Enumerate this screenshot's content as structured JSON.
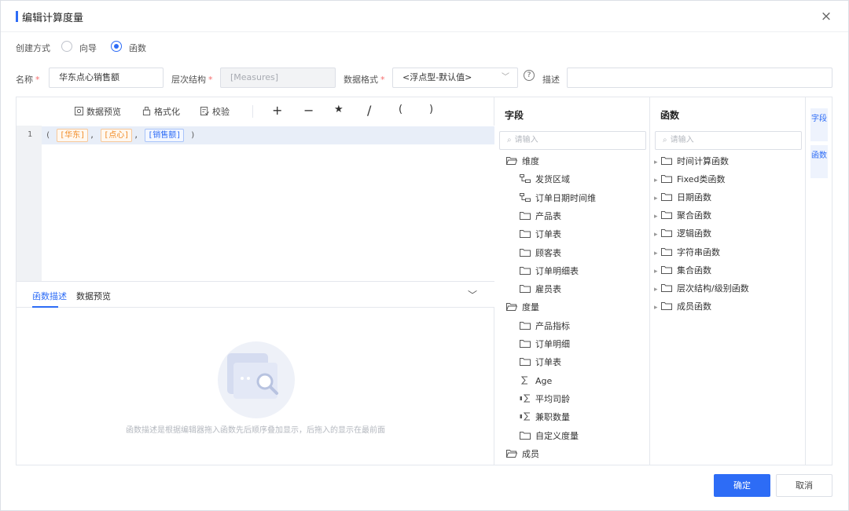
{
  "dialog": {
    "title": "编辑计算度量",
    "close": "×"
  },
  "creation": {
    "label": "创建方式",
    "options": [
      "向导",
      "函数"
    ],
    "selected_index": 1
  },
  "form": {
    "name_label": "名称",
    "name_value": "华东点心销售额",
    "hierarchy_label": "层次结构",
    "hierarchy_value": "[Measures]",
    "format_label": "数据格式",
    "format_value": "<浮点型-默认值>",
    "help_icon": "?",
    "desc_label": "描述",
    "desc_value": "",
    "required_mark": "*"
  },
  "toolbar": {
    "preview": "数据预览",
    "format": "格式化",
    "validate": "校验",
    "ops": [
      "+",
      "−",
      "★",
      "/",
      "(",
      ")"
    ]
  },
  "editor": {
    "line_number": "1",
    "open_paren": "(",
    "close_paren": ")",
    "comma": ",",
    "tokens": [
      "[华东]",
      "[点心]",
      "[销售额]"
    ]
  },
  "bottom_panel": {
    "tabs": [
      "函数描述",
      "数据预览"
    ],
    "active_tab": 0,
    "empty_text": "函数描述是根据编辑器拖入函数先后顺序叠加显示，后拖入的显示在最前面"
  },
  "fields": {
    "title": "字段",
    "search_placeholder": "请输入",
    "tree": [
      {
        "label": "维度",
        "level": 0,
        "icon": "folder-open-icon"
      },
      {
        "label": "发货区域",
        "level": 1,
        "icon": "hierarchy-icon"
      },
      {
        "label": "订单日期时间维",
        "level": 1,
        "icon": "hierarchy-icon"
      },
      {
        "label": "产品表",
        "level": 1,
        "icon": "folder-icon"
      },
      {
        "label": "订单表",
        "level": 1,
        "icon": "folder-icon"
      },
      {
        "label": "顾客表",
        "level": 1,
        "icon": "folder-icon"
      },
      {
        "label": "订单明细表",
        "level": 1,
        "icon": "folder-icon"
      },
      {
        "label": "雇员表",
        "level": 1,
        "icon": "folder-icon"
      },
      {
        "label": "度量",
        "level": 0,
        "icon": "folder-open-icon"
      },
      {
        "label": "产品指标",
        "level": 1,
        "icon": "folder-icon"
      },
      {
        "label": "订单明细",
        "level": 1,
        "icon": "folder-icon"
      },
      {
        "label": "订单表",
        "level": 1,
        "icon": "folder-icon"
      },
      {
        "label": "Age",
        "level": 1,
        "icon": "sigma-icon"
      },
      {
        "label": "平均司龄",
        "level": 1,
        "icon": "calc-measure-icon"
      },
      {
        "label": "兼职数量",
        "level": 1,
        "icon": "calc-measure-icon"
      },
      {
        "label": "自定义度量",
        "level": 1,
        "icon": "folder-icon"
      },
      {
        "label": "成员",
        "level": 0,
        "icon": "folder-open-icon"
      }
    ]
  },
  "functions": {
    "title": "函数",
    "search_placeholder": "请输入",
    "items": [
      "时间计算函数",
      "Fixed类函数",
      "日期函数",
      "聚合函数",
      "逻辑函数",
      "字符串函数",
      "集合函数",
      "层次结构/级别函数",
      "成员函数"
    ]
  },
  "side_tabs": [
    "字段",
    "函数"
  ],
  "footer": {
    "ok": "确定",
    "cancel": "取消"
  },
  "colors": {
    "accent": "#2d6cf6",
    "token_orange": "#f08a24",
    "required": "#f56c6c"
  }
}
